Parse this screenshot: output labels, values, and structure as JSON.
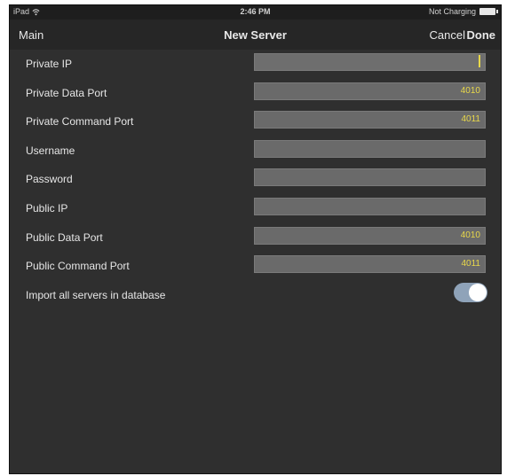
{
  "status_bar": {
    "device": "iPad",
    "time": "2:46 PM",
    "battery_status": "Not Charging"
  },
  "nav": {
    "back_label": "Main",
    "title": "New Server",
    "cancel_label": "Cancel",
    "done_label": "Done"
  },
  "form": {
    "fields": [
      {
        "label": "Private IP",
        "value": ""
      },
      {
        "label": "Private Data Port",
        "value": "4010"
      },
      {
        "label": "Private Command Port",
        "value": "4011"
      },
      {
        "label": "Username",
        "value": ""
      },
      {
        "label": "Password",
        "value": ""
      },
      {
        "label": "Public IP",
        "value": ""
      },
      {
        "label": "Public Data Port",
        "value": "4010"
      },
      {
        "label": "Public Command Port",
        "value": "4011"
      }
    ],
    "import_toggle": {
      "label": "Import all servers in database",
      "on": true
    }
  },
  "colors": {
    "background": "#2f2f2f",
    "navbar": "#262626",
    "field": "#6a6a6a",
    "value_text": "#e8d84a",
    "toggle_on": "#8fa3b9"
  }
}
